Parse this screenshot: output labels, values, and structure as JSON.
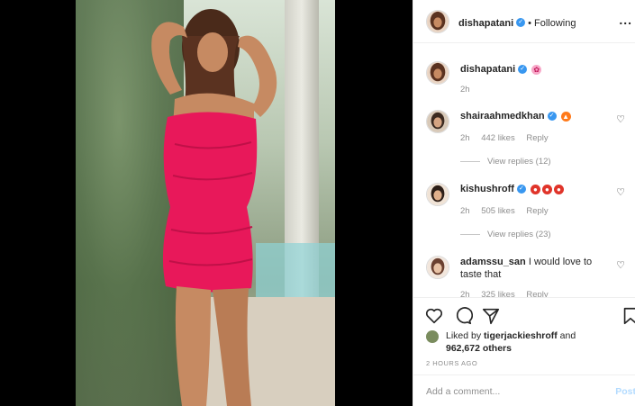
{
  "header": {
    "username": "dishapatani",
    "separator": "•",
    "follow_status": "Following",
    "more_label": "..."
  },
  "caption": {
    "username": "dishapatani",
    "emoji": "flower",
    "time": "2h"
  },
  "comments": [
    {
      "username": "shairaahmedkhan",
      "text": "",
      "emoji": [
        "fire"
      ],
      "time": "2h",
      "likes": "442 likes",
      "reply_label": "Reply",
      "view_replies": "View replies (12)"
    },
    {
      "username": "kishushroff",
      "text": "",
      "emoji": [
        "angry",
        "angry",
        "angry"
      ],
      "time": "2h",
      "likes": "505 likes",
      "reply_label": "Reply",
      "view_replies": "View replies (23)"
    },
    {
      "username": "adamssu_san",
      "text": "I would love to taste that",
      "time": "2h",
      "likes": "325 likes",
      "reply_label": "Reply"
    }
  ],
  "actions": {
    "liked_prefix": "Liked by",
    "liked_user": "tigerjackieshroff",
    "liked_and": "and",
    "likes_count": "962,672 others",
    "time_ago": "2 HOURS AGO"
  },
  "add_comment": {
    "placeholder": "Add a comment...",
    "post_label": "Post"
  },
  "colors": {
    "verified": "#3897f0",
    "dress": "#e8185a",
    "post_button": "#b3dbff"
  },
  "icons": [
    "heart-icon",
    "comment-icon",
    "share-icon",
    "bookmark-icon",
    "verified-icon",
    "more-icon"
  ]
}
